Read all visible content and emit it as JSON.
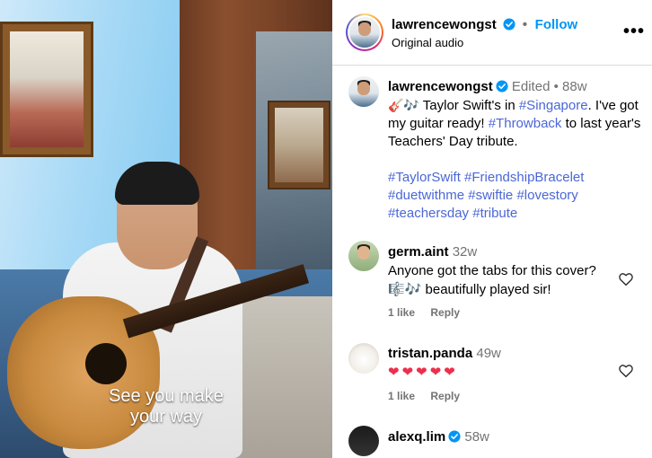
{
  "video": {
    "subtitle_line1": "See you make",
    "subtitle_line2": "your way"
  },
  "header": {
    "username": "lawrencewongst",
    "separator": "•",
    "follow_label": "Follow",
    "audio_label": "Original audio",
    "more_icon": "more-horizontal-icon"
  },
  "caption": {
    "username": "lawrencewongst",
    "edited": "Edited",
    "separator": "•",
    "age": "88w",
    "emoji_prefix": "🎸🎶",
    "text_1": "Taylor Swift's in ",
    "tag_singapore": "#Singapore",
    "text_2": ". I've got my guitar ready! ",
    "tag_throwback": "#Throwback",
    "text_3": " to last year's Teachers' Day tribute.",
    "hashtags": [
      "#TaylorSwift",
      "#FriendshipBracelet",
      "#duetwithme",
      "#swiftie",
      "#lovestory",
      "#teachersday",
      "#tribute"
    ]
  },
  "comments": [
    {
      "username": "germ.aint",
      "age": "32w",
      "text": "Anyone got the tabs for this cover?",
      "text2": "🎼🎶 beautifully played sir!",
      "likes": "1 like",
      "reply": "Reply"
    },
    {
      "username": "tristan.panda",
      "age": "49w",
      "text": "❤❤❤❤❤",
      "likes": "1 like",
      "reply": "Reply"
    },
    {
      "username": "alexq.lim",
      "age": "58w"
    }
  ],
  "colors": {
    "link": "#0095f6",
    "hashtag": "#4b67d6",
    "verified": "#0095f6",
    "heart": "#ed2e4d"
  }
}
